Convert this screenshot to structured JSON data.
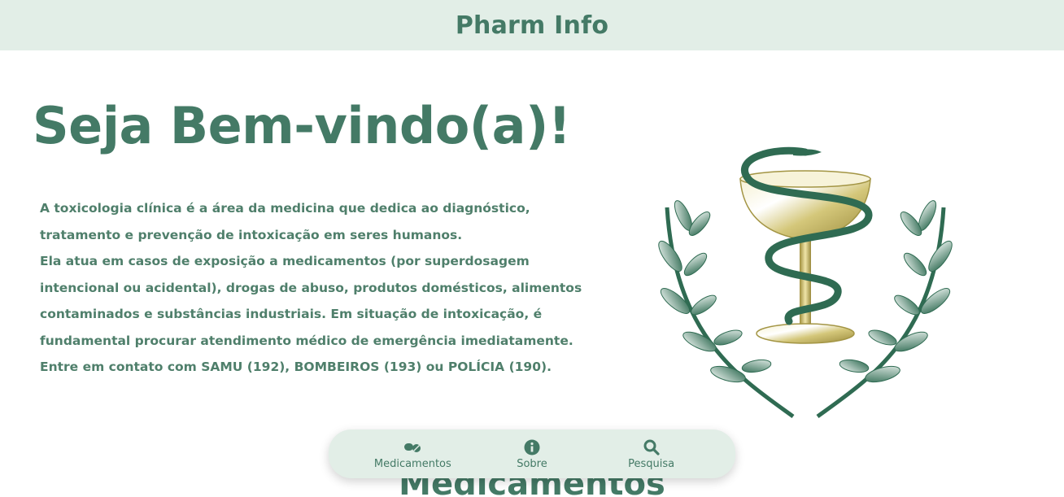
{
  "header": {
    "brand": "Pharm Info"
  },
  "hero": {
    "title": "Seja Bem-vindo(a)!",
    "lines": [
      "A toxicologia clínica é a área da medicina que dedica ao diagnóstico,",
      "tratamento e prevenção de intoxicação em seres humanos.",
      "Ela atua em casos de exposição a medicamentos (por superdosagem",
      "intencional ou acidental), drogas de abuso, produtos domésticos, alimentos",
      "contaminados e substâncias industriais. Em situação de intoxicação, é",
      "fundamental procurar atendimento médico de emergência imediatamente.",
      "Entre em contato com SAMU (192), BOMBEIROS (193) ou POLÍCIA (190)."
    ]
  },
  "section": {
    "heading": "Medicamentos"
  },
  "nav": {
    "items": [
      {
        "label": "Medicamentos",
        "icon": "pills-icon"
      },
      {
        "label": "Sobre",
        "icon": "info-icon"
      },
      {
        "label": "Pesquisa",
        "icon": "search-icon"
      }
    ]
  },
  "colors": {
    "primary": "#447a66",
    "header_bg": "#e2eee7",
    "gold": "#c9b85a",
    "leaf": "#2f6b52"
  }
}
